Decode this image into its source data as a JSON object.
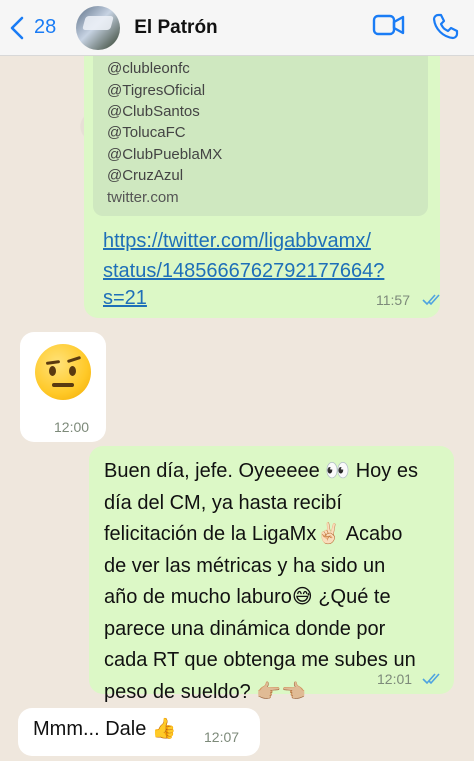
{
  "header": {
    "back_count": "28",
    "contact_name": "El Patrón",
    "accent": "#1a7cf5"
  },
  "link_preview": {
    "handles": [
      "@clubleonfc",
      "@TigresOficial",
      "@ClubSantos",
      "@TolucaFC",
      "@ClubPueblaMX",
      "@CruzAzul"
    ],
    "domain": "twitter.com"
  },
  "messages": [
    {
      "direction": "outgoing",
      "link_lines": [
        "https://twitter.com/ligabbvamx/",
        "status/1485666762792177664?",
        "s=21"
      ],
      "time": "11:57",
      "status": "read"
    },
    {
      "direction": "incoming",
      "emoji": "raised-eyebrow-face",
      "time": "12:00"
    },
    {
      "direction": "outgoing",
      "lines": [
        "Buen día, jefe. Oyeeeee 👀 Hoy es",
        "día del CM, ya hasta recibí",
        "felicitación de la LigaMx✌🏻 Acabo",
        "de ver las métricas y ha sido un",
        "año de mucho laburo😅 ¿Qué te",
        "parece una dinámica donde por",
        "cada RT que obtenga me subes un",
        "peso de sueldo? 👉🏼👈🏼"
      ],
      "time": "12:01",
      "status": "read"
    },
    {
      "direction": "incoming",
      "text": "Mmm... Dale 👍",
      "time": "12:07"
    }
  ],
  "colors": {
    "outgoing_bubble": "#dcf8c6",
    "incoming_bubble": "#ffffff",
    "link": "#1e6fb8",
    "read_ticks": "#4fa3e0"
  }
}
